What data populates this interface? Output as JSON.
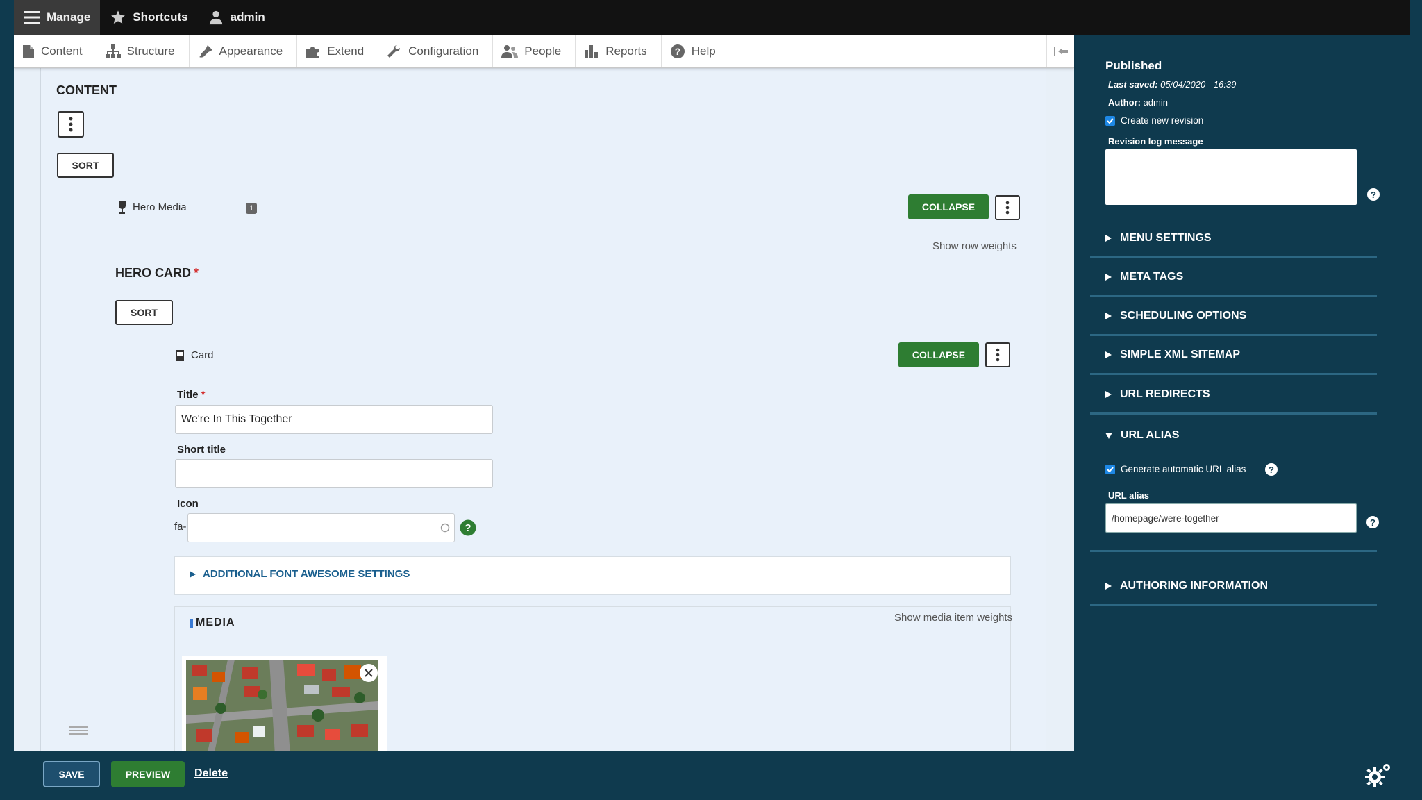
{
  "toolbar": {
    "manage": "Manage",
    "shortcuts": "Shortcuts",
    "user": "admin"
  },
  "tray": {
    "items": [
      "Content",
      "Structure",
      "Appearance",
      "Extend",
      "Configuration",
      "People",
      "Reports",
      "Help"
    ]
  },
  "content": {
    "section_title": "CONTENT",
    "sort_label": "SORT",
    "hero_media_label": "Hero Media",
    "hero_media_badge": "1",
    "collapse_label": "COLLAPSE",
    "show_row_weights": "Show row weights",
    "hero_card_title": "HERO CARD",
    "required_mark": "*",
    "card_label": "Card",
    "title_label": "Title",
    "title_value": "We're In This Together",
    "short_title_label": "Short title",
    "short_title_value": "",
    "icon_label": "Icon",
    "icon_prefix": "fa-",
    "icon_value": "",
    "font_awesome_settings": "ADDITIONAL FONT AWESOME SETTINGS",
    "media_title": "MEDIA",
    "show_media_weights": "Show media item weights"
  },
  "sidebar": {
    "status": "Published",
    "last_saved_label": "Last saved:",
    "last_saved_value": "05/04/2020 - 16:39",
    "author_label": "Author:",
    "author_value": "admin",
    "create_revision": "Create new revision",
    "revision_log_label": "Revision log message",
    "sections": [
      "MENU SETTINGS",
      "META TAGS",
      "SCHEDULING OPTIONS",
      "SIMPLE XML SITEMAP",
      "URL REDIRECTS"
    ],
    "url_alias_section": "URL ALIAS",
    "generate_alias": "Generate automatic URL alias",
    "url_alias_label": "URL alias",
    "url_alias_value": "/homepage/were-together",
    "authoring_information": "AUTHORING INFORMATION"
  },
  "actions": {
    "save": "SAVE",
    "preview": "PREVIEW",
    "delete": "Delete"
  },
  "colors": {
    "toolbar_bg": "#121212",
    "sidebar_bg": "#0f3a4e",
    "collapse_green": "#2e7d32",
    "link_blue": "#1a5f8e",
    "required_red": "#d32f2f"
  }
}
